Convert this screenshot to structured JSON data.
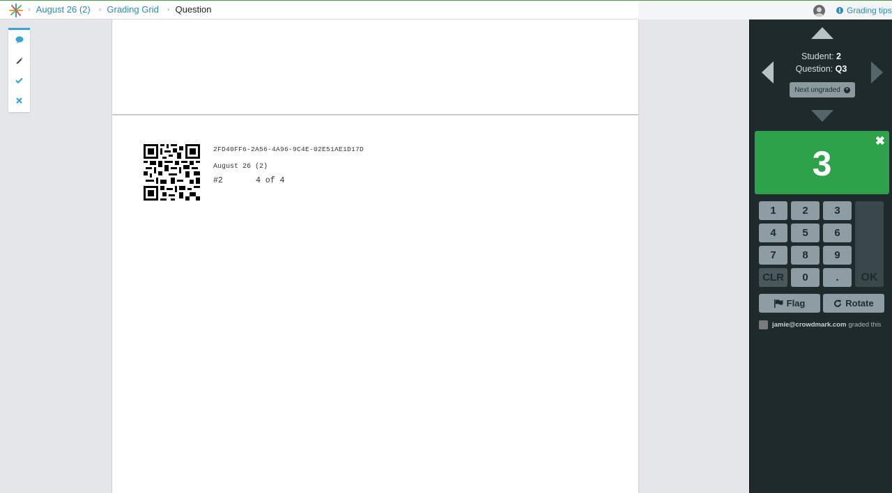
{
  "breadcrumb": {
    "items": [
      {
        "label": "August 26 (2)"
      },
      {
        "label": "Grading Grid"
      }
    ],
    "current": "Question"
  },
  "header": {
    "tips_label": "Grading tips"
  },
  "toolbar": {
    "tools": [
      "comment-icon",
      "pencil-icon",
      "check-icon",
      "close-icon"
    ]
  },
  "page": {
    "uuid": "2FD40FF6-2A56-4A96-9C4E-02E51AE1D17D",
    "exam_name": "August 26 (2)",
    "student_number": "#2",
    "page_of": "4 of 4"
  },
  "panel": {
    "student_label": "Student:",
    "student_value": "2",
    "question_label": "Question:",
    "question_value": "Q3",
    "next_ungraded": "Next ungraded",
    "score": "3",
    "keypad": [
      "1",
      "2",
      "3",
      "4",
      "5",
      "6",
      "7",
      "8",
      "9",
      "CLR",
      "0",
      ".",
      "OK"
    ],
    "flag_label": "Flag",
    "rotate_label": "Rotate",
    "grader_email": "jamie@crowdmark.com",
    "graded_text": "graded this"
  },
  "colors": {
    "accent": "#2b8ab8",
    "score_bg": "#2ea24a",
    "panel_bg": "#1f2a2c"
  }
}
